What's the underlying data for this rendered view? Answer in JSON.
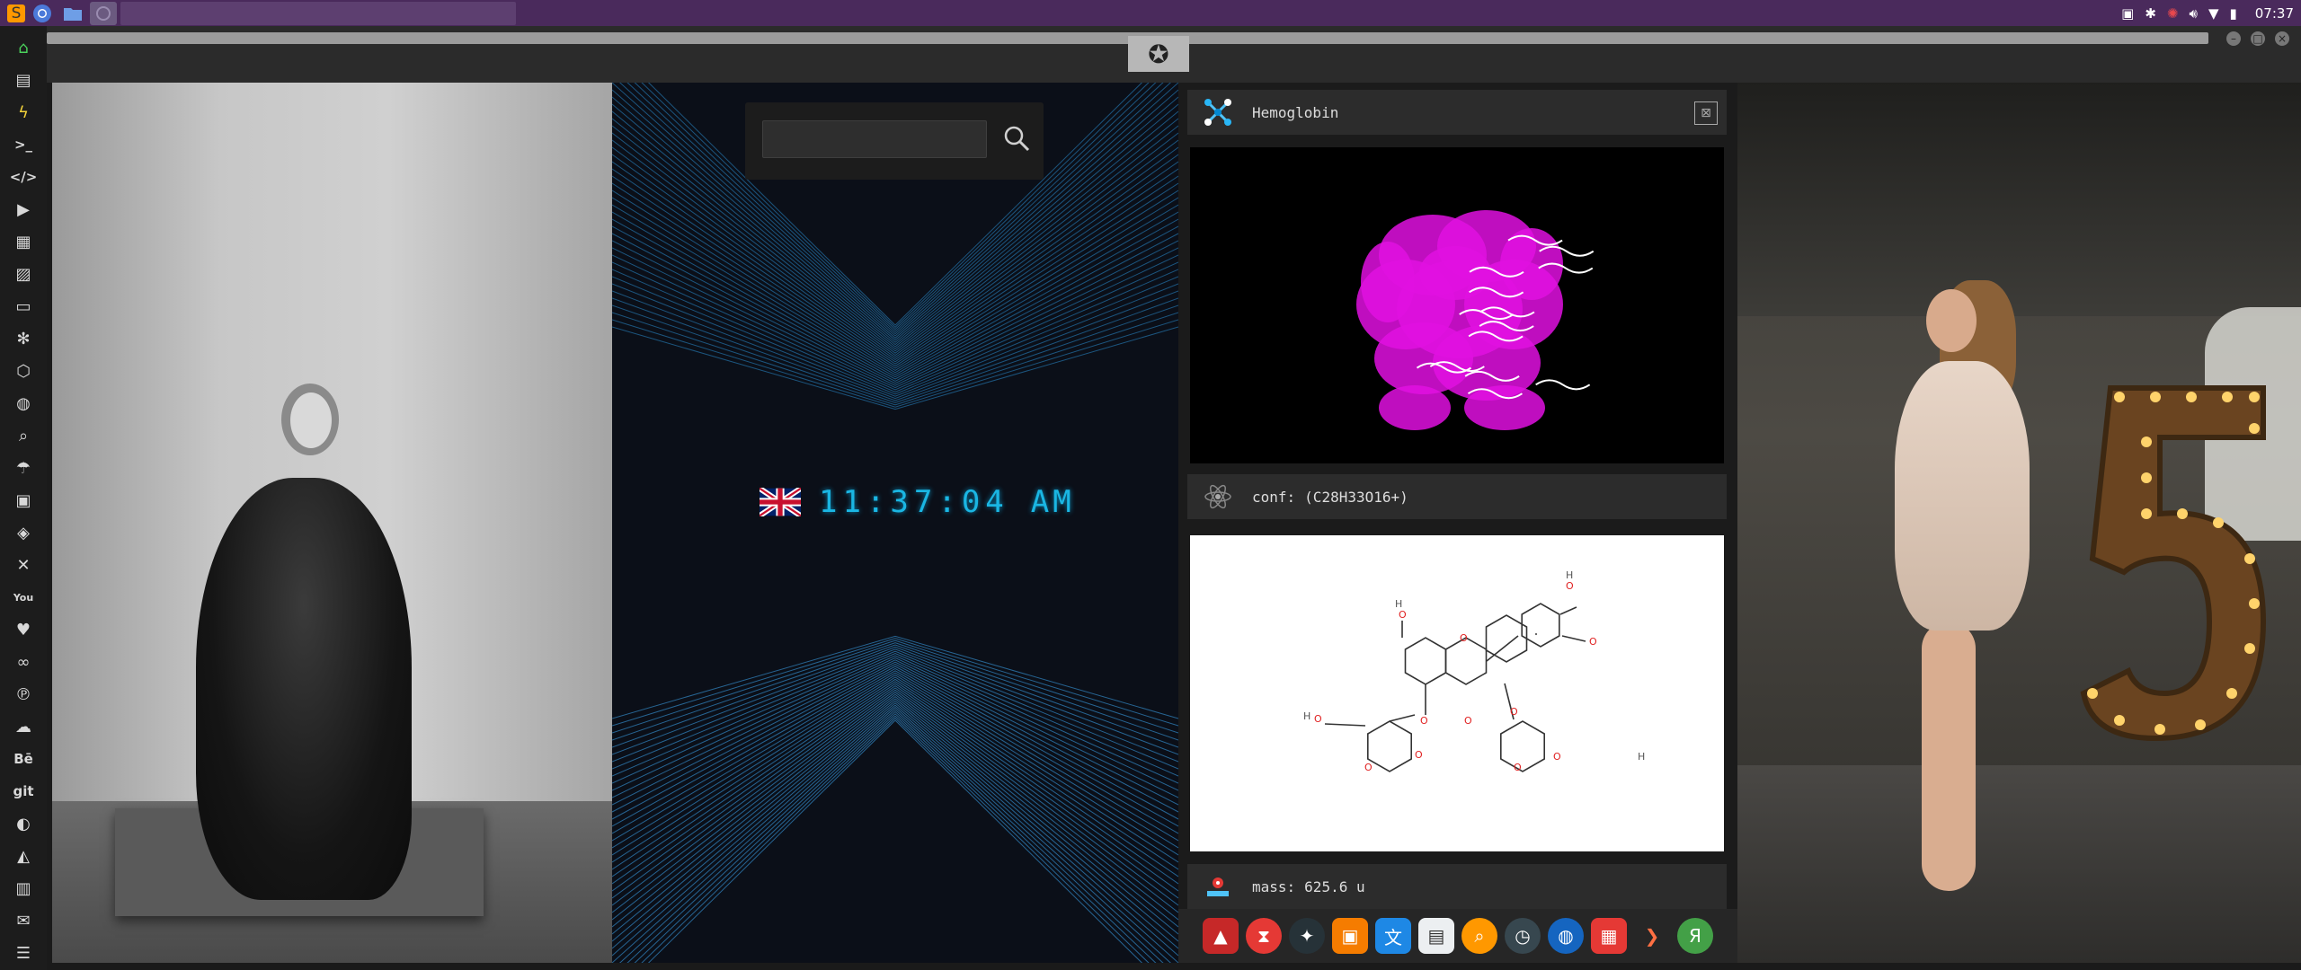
{
  "topbar": {
    "apps": [
      "sublime-text",
      "chromium",
      "files",
      "window-switcher"
    ],
    "time": "07:37"
  },
  "left_dock": {
    "items": [
      "home",
      "document",
      "bolt",
      "terminal",
      "code",
      "play",
      "files",
      "image",
      "card",
      "settings",
      "hexagon",
      "globe",
      "search",
      "umbrella",
      "contact",
      "diamond",
      "tools",
      "youtube",
      "heart",
      "infinity",
      "pinterest",
      "cloud",
      "Bē",
      "git",
      "github",
      "layers",
      "map",
      "mail",
      "server"
    ]
  },
  "clock_widget": {
    "search_placeholder": "",
    "time": "11:37:04",
    "ampm": "AM"
  },
  "molecule_widget": {
    "name": "Hemoglobin",
    "conf_label": "conf:",
    "conf_value": "(C28H33O16+)",
    "mass_label": "mass:",
    "mass_value": "625.6 u",
    "close_label": "⊠"
  },
  "bottom_dock": {
    "apps": [
      "autodesk",
      "timer",
      "astronomy",
      "photos",
      "translate",
      "calendar-notes",
      "search",
      "clock",
      "globe",
      "calendar",
      "arrow",
      "yandex"
    ]
  },
  "colors": {
    "panel_purple": "#4a2a5c",
    "clock_cyan": "#1ab6e3",
    "protein_magenta": "#e010e0"
  }
}
